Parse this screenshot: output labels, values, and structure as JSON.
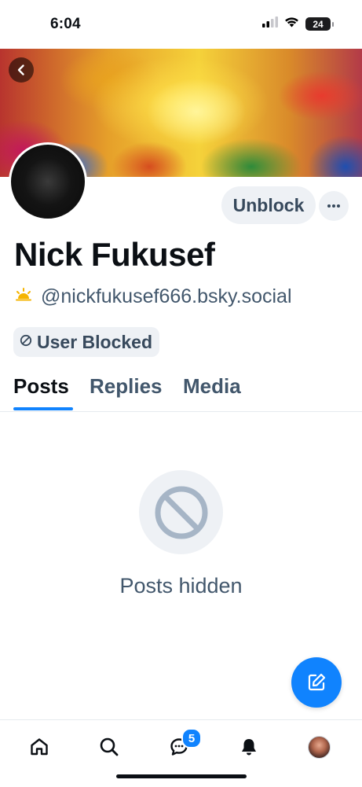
{
  "status_bar": {
    "time": "6:04",
    "battery": "24",
    "icons": [
      "cellular-signal-icon",
      "wifi-icon",
      "battery-icon"
    ]
  },
  "profile": {
    "display_name": "Nick Fukusef",
    "handle": "@nickfukusef666.bsky.social",
    "handle_icon": "sun-emoji-icon",
    "unblock_label": "Unblock",
    "more_icon": "ellipsis-icon",
    "blocked_label": "User Blocked",
    "blocked_icon": "blocked-circle-icon"
  },
  "tabs": [
    {
      "label": "Posts",
      "active": true
    },
    {
      "label": "Replies",
      "active": false
    },
    {
      "label": "Media",
      "active": false
    }
  ],
  "empty_state": {
    "icon": "blocked-circle-icon",
    "message": "Posts hidden"
  },
  "fab": {
    "icon": "compose-icon"
  },
  "bottom_nav": {
    "items": [
      {
        "name": "home",
        "icon": "home-icon"
      },
      {
        "name": "search",
        "icon": "search-icon"
      },
      {
        "name": "chat",
        "icon": "chat-icon",
        "badge": "5"
      },
      {
        "name": "notifications",
        "icon": "bell-icon"
      },
      {
        "name": "profile",
        "icon": "avatar-icon"
      }
    ]
  },
  "colors": {
    "accent": "#1083fe",
    "muted_text": "#42576c",
    "pill_bg": "#eef1f5",
    "primary_text": "#0b0f14"
  }
}
